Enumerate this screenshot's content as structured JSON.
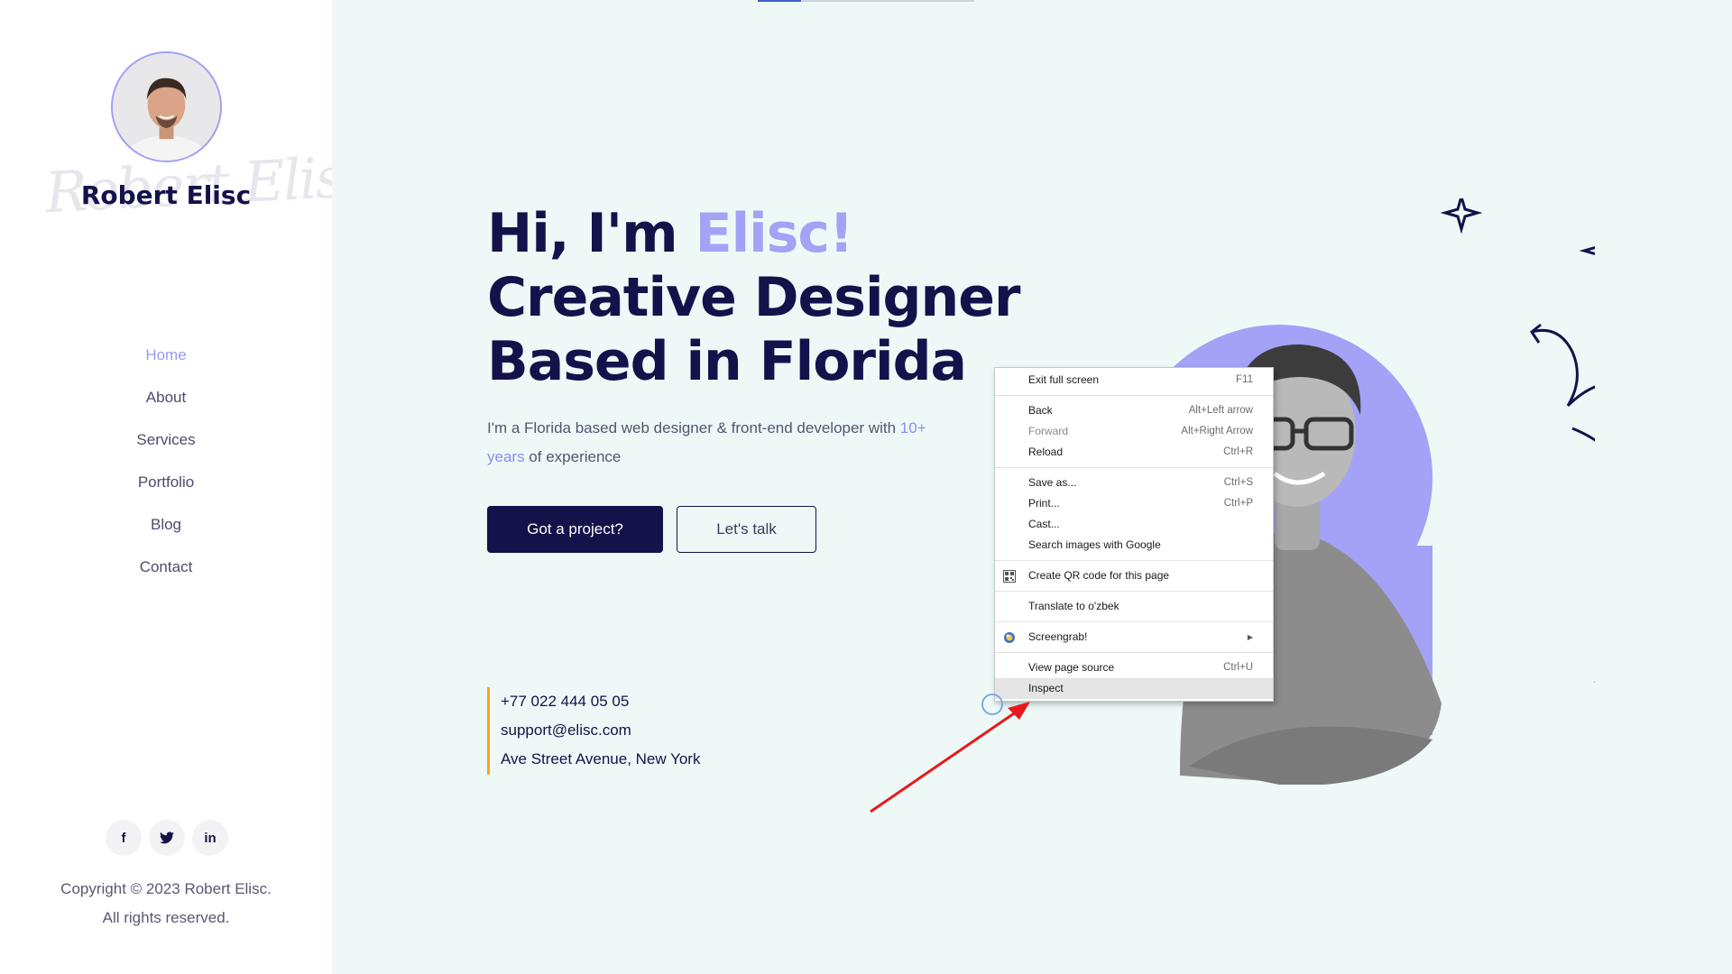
{
  "sidebar": {
    "signature": "Robert Elisc",
    "name": "Robert Elisc",
    "nav": [
      {
        "label": "Home",
        "active": true
      },
      {
        "label": "About"
      },
      {
        "label": "Services"
      },
      {
        "label": "Portfolio"
      },
      {
        "label": "Blog"
      },
      {
        "label": "Contact"
      }
    ],
    "socials": [
      {
        "icon": "facebook-icon",
        "glyph": "f"
      },
      {
        "icon": "twitter-icon",
        "glyph": "t"
      },
      {
        "icon": "linkedin-icon",
        "glyph": "in"
      }
    ],
    "copyright_line1": "Copyright © 2023 Robert Elisc.",
    "copyright_line2": "All rights reserved."
  },
  "hero": {
    "greeting": "Hi, I'm ",
    "name_accent": "Elisc!",
    "line2": "Creative Designer",
    "line3": "Based in Florida",
    "intro_part1": "I'm a Florida based web designer & front-end developer with ",
    "intro_accent": "10+ years",
    "intro_part2": " of experience",
    "primary_button": "Got a project?",
    "secondary_button": "Let's talk"
  },
  "contact": {
    "phone": "+77 022 444 05 05",
    "email": "support@elisc.com",
    "address": "Ave Street Avenue, New York"
  },
  "context_menu": {
    "groups": [
      [
        {
          "label": "Exit full screen",
          "shortcut": "F11"
        }
      ],
      [
        {
          "label": "Back",
          "shortcut": "Alt+Left arrow"
        },
        {
          "label": "Forward",
          "shortcut": "Alt+Right Arrow",
          "disabled": true
        },
        {
          "label": "Reload",
          "shortcut": "Ctrl+R"
        }
      ],
      [
        {
          "label": "Save as...",
          "shortcut": "Ctrl+S"
        },
        {
          "label": "Print...",
          "shortcut": "Ctrl+P"
        },
        {
          "label": "Cast..."
        },
        {
          "label": "Search images with Google"
        }
      ],
      [
        {
          "label": "Create QR code for this page",
          "icon": "qr-code-icon"
        }
      ],
      [
        {
          "label": "Translate to o'zbek"
        }
      ],
      [
        {
          "label": "Screengrab!",
          "icon": "screengrab-icon",
          "submenu": true
        }
      ],
      [
        {
          "label": "View page source",
          "shortcut": "Ctrl+U"
        },
        {
          "label": "Inspect",
          "highlighted": true
        }
      ]
    ]
  },
  "colors": {
    "navy": "#14124a",
    "accent_purple": "#a3a2f7",
    "main_bg": "#eef9f7",
    "contact_bar": "#f5a623",
    "arrow_red": "#e8191b"
  }
}
